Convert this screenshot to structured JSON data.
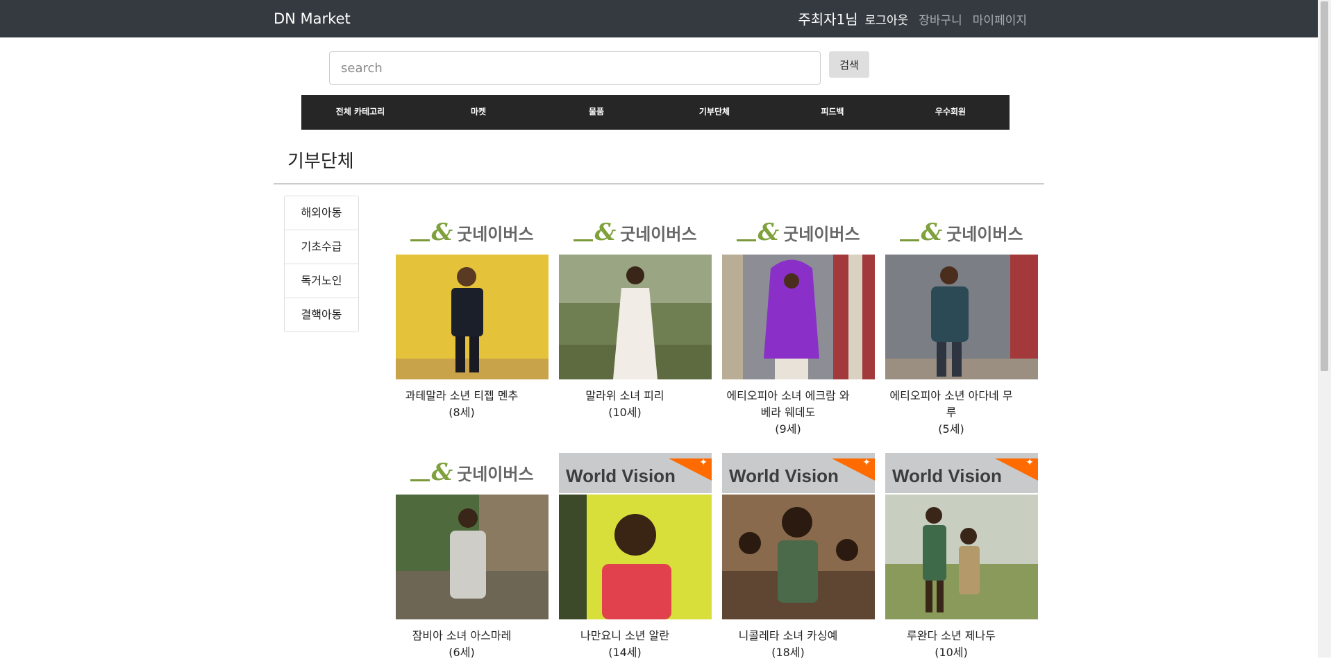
{
  "navbar": {
    "brand": "DN Market",
    "user": "주최자1님",
    "logout": "로그아웃",
    "cart": "장바구니",
    "mypage": "마이페이지"
  },
  "search": {
    "placeholder": "search",
    "value": "",
    "button": "검색"
  },
  "category_nav": [
    "전체 카테고리",
    "마켓",
    "물품",
    "기부단체",
    "피드백",
    "우수회원"
  ],
  "page_title": "기부단체",
  "sidebar": [
    "해외아동",
    "기초수급",
    "독거노인",
    "결핵아동"
  ],
  "logos": {
    "goodneighbors": "굿네이버스",
    "worldvision": "World Vision"
  },
  "cards": [
    {
      "org": "goodneighbors",
      "name": "과테말라 소년 티젭 멘추",
      "age": "(8세)"
    },
    {
      "org": "goodneighbors",
      "name": "말라위 소녀 피리",
      "age": "(10세)"
    },
    {
      "org": "goodneighbors",
      "name": "에티오피아 소녀 에크람 와베라 웨데도",
      "age": "(9세)"
    },
    {
      "org": "goodneighbors",
      "name": "에티오피아 소년 아다네 무루",
      "age": "(5세)"
    },
    {
      "org": "goodneighbors",
      "name": "잠비아 소녀 아스마레",
      "age": "(6세)"
    },
    {
      "org": "worldvision",
      "name": "나만요니 소년 알란",
      "age": "(14세)"
    },
    {
      "org": "worldvision",
      "name": "니콜레타 소녀 카싱예",
      "age": "(18세)"
    },
    {
      "org": "worldvision",
      "name": "루완다 소년 제나두",
      "age": "(10세)"
    }
  ],
  "colors": {
    "navbar": "#343a40",
    "category_bar": "#262626",
    "goodneighbors_green": "#7fa13c",
    "worldvision_orange": "#ff6b00"
  }
}
